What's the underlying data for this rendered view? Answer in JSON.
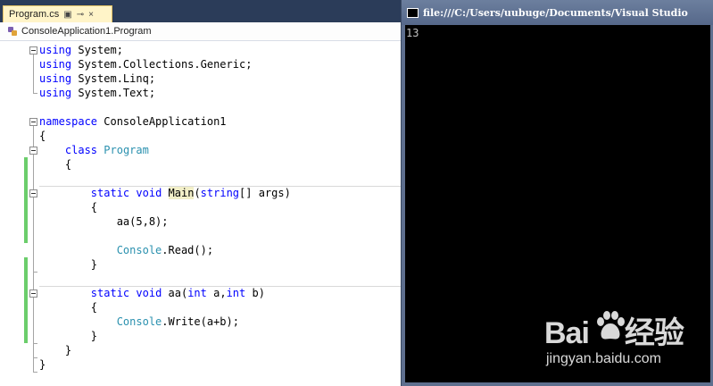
{
  "editor": {
    "tab": {
      "label": "Program.cs",
      "pin_glyph": "⊕",
      "lock_glyph": "🔒",
      "close_glyph": "×"
    },
    "navbar": {
      "scope": "ConsoleApplication1.Program"
    },
    "lines": [
      [
        {
          "t": "using",
          "c": "kw"
        },
        {
          "t": " System;"
        }
      ],
      [
        {
          "t": "using",
          "c": "kw"
        },
        {
          "t": " System.Collections.Generic;"
        }
      ],
      [
        {
          "t": "using",
          "c": "kw"
        },
        {
          "t": " System.Linq;"
        }
      ],
      [
        {
          "t": "using",
          "c": "kw"
        },
        {
          "t": " System.Text;"
        }
      ],
      [],
      [
        {
          "t": "namespace",
          "c": "kw"
        },
        {
          "t": " ConsoleApplication1"
        }
      ],
      [
        {
          "t": "{"
        }
      ],
      [
        {
          "t": "    "
        },
        {
          "t": "class",
          "c": "kw"
        },
        {
          "t": " "
        },
        {
          "t": "Program",
          "c": "ty"
        }
      ],
      [
        {
          "t": "    {"
        }
      ],
      [],
      [
        {
          "t": "        "
        },
        {
          "t": "static",
          "c": "kw"
        },
        {
          "t": " "
        },
        {
          "t": "void",
          "c": "kw"
        },
        {
          "t": " "
        },
        {
          "t": "Main",
          "c": "hl"
        },
        {
          "t": "("
        },
        {
          "t": "string",
          "c": "kw"
        },
        {
          "t": "[] args)"
        }
      ],
      [
        {
          "t": "        {"
        }
      ],
      [
        {
          "t": "            aa(5,8);"
        }
      ],
      [],
      [
        {
          "t": "            "
        },
        {
          "t": "Console",
          "c": "ty"
        },
        {
          "t": ".Read();"
        }
      ],
      [
        {
          "t": "        }"
        }
      ],
      [],
      [
        {
          "t": "        "
        },
        {
          "t": "static",
          "c": "kw"
        },
        {
          "t": " "
        },
        {
          "t": "void",
          "c": "kw"
        },
        {
          "t": " aa("
        },
        {
          "t": "int",
          "c": "kw"
        },
        {
          "t": " a,"
        },
        {
          "t": "int",
          "c": "kw"
        },
        {
          "t": " b)"
        }
      ],
      [
        {
          "t": "        {"
        }
      ],
      [
        {
          "t": "            "
        },
        {
          "t": "Console",
          "c": "ty"
        },
        {
          "t": ".Write(a+b);"
        }
      ],
      [
        {
          "t": "        }"
        }
      ],
      [
        {
          "t": "    }"
        }
      ],
      [
        {
          "t": "}"
        }
      ]
    ]
  },
  "console": {
    "title": "file:///C:/Users/uubuge/Documents/Visual Studio",
    "output": "13"
  },
  "watermark": {
    "logo_left": "Bai",
    "logo_right": "经验",
    "url": "jingyan.baidu.com"
  },
  "colors": {
    "keyword": "#0000ff",
    "type": "#2b91af",
    "changed": "#6bcd6b",
    "console_bg": "#000000",
    "console_fg": "#c0c0c0"
  }
}
